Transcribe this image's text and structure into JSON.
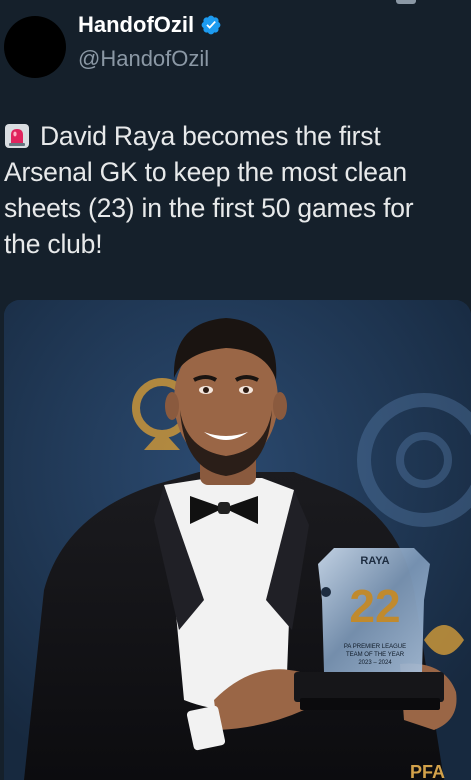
{
  "tweet": {
    "display_name": "HandofOzil",
    "handle": "@HandofOzil",
    "text": "David Raya becomes the first Arsenal GK to keep the most clean sheets (23) in the first 50 games for the club!",
    "text_lines": [
      "David Raya becomes the first",
      "Arsenal GK to keep the most clean",
      "sheets (23) in the first 50 games for",
      "the club!"
    ]
  },
  "media": {
    "trophy_name": "RAYA",
    "trophy_number": "22",
    "trophy_line1": "PA PREMIER LEAGUE",
    "trophy_line2": "TEAM OF THE YEAR",
    "trophy_line3": "2023 – 2024",
    "backdrop_text": "PFA"
  },
  "icons": {
    "verified": "verified-badge-icon",
    "siren": "rotating-light-emoji"
  },
  "colors": {
    "background": "#15202b",
    "verified": "#1d9bf0",
    "backdrop": "#1f3653"
  }
}
